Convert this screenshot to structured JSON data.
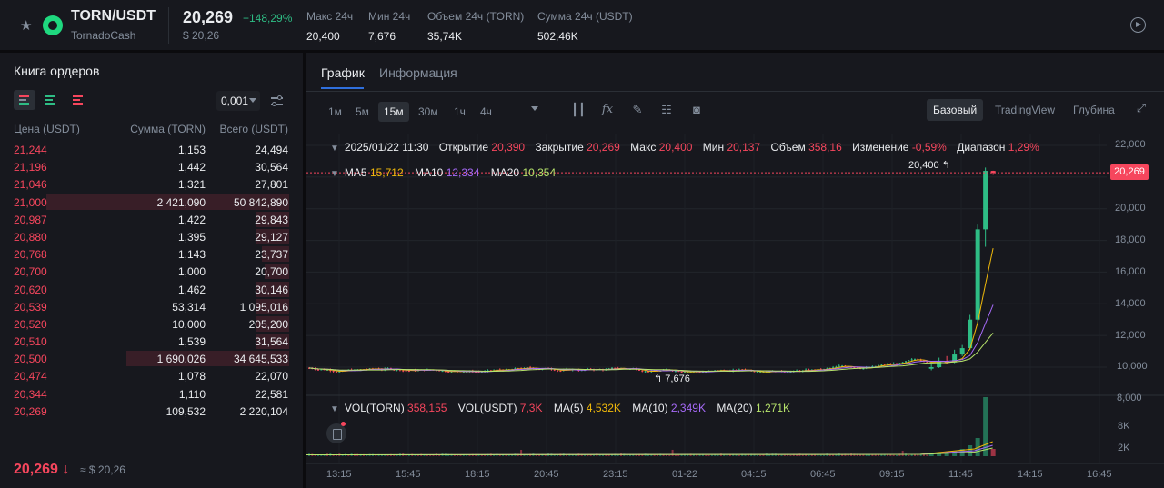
{
  "header": {
    "pair": "TORN/USDT",
    "name": "TornadoCash",
    "last_price": "20,269",
    "change": "+148,29%",
    "last_usd": "$ 20,26",
    "stats": [
      {
        "label": "Макс 24ч",
        "value": "20,400"
      },
      {
        "label": "Мин 24ч",
        "value": "7,676"
      },
      {
        "label": "Объем 24ч (TORN)",
        "value": "35,74K"
      },
      {
        "label": "Сумма 24ч (USDT)",
        "value": "502,46K"
      }
    ]
  },
  "orderbook": {
    "title": "Книга ордеров",
    "tick": "0,001",
    "col_price": "Цена (USDT)",
    "col_amount": "Сумма (TORN)",
    "col_total": "Всего (USDT)",
    "rows": [
      {
        "price": "21,244",
        "amount": "1,153",
        "total": "24,494",
        "depth": 0.0
      },
      {
        "price": "21,196",
        "amount": "1,442",
        "total": "30,564",
        "depth": 0.0
      },
      {
        "price": "21,046",
        "amount": "1,321",
        "total": "27,801",
        "depth": 0.0
      },
      {
        "price": "21,000",
        "amount": "2 421,090",
        "total": "50 842,890",
        "depth": 0.88
      },
      {
        "price": "20,987",
        "amount": "1,422",
        "total": "29,843",
        "depth": 0.12
      },
      {
        "price": "20,880",
        "amount": "1,395",
        "total": "29,127",
        "depth": 0.12
      },
      {
        "price": "20,768",
        "amount": "1,143",
        "total": "23,737",
        "depth": 0.1
      },
      {
        "price": "20,700",
        "amount": "1,000",
        "total": "20,700",
        "depth": 0.09
      },
      {
        "price": "20,620",
        "amount": "1,462",
        "total": "30,146",
        "depth": 0.12
      },
      {
        "price": "20,539",
        "amount": "53,314",
        "total": "1 095,016",
        "depth": 0.12
      },
      {
        "price": "20,520",
        "amount": "10,000",
        "total": "205,200",
        "depth": 0.12
      },
      {
        "price": "20,510",
        "amount": "1,539",
        "total": "31,564",
        "depth": 0.12
      },
      {
        "price": "20,500",
        "amount": "1 690,026",
        "total": "34 645,533",
        "depth": 0.59
      },
      {
        "price": "20,474",
        "amount": "1,078",
        "total": "22,070",
        "depth": 0.0
      },
      {
        "price": "20,344",
        "amount": "1,110",
        "total": "22,581",
        "depth": 0.0
      },
      {
        "price": "20,269",
        "amount": "109,532",
        "total": "2 220,104",
        "depth": 0.0
      }
    ],
    "last_price": "20,269",
    "last_arrow": "↓",
    "last_usd": "≈ $ 20,26"
  },
  "chart_panel": {
    "tabs": [
      "График",
      "Информация"
    ],
    "timeframes": [
      "1м",
      "5м",
      "15м",
      "30м",
      "1ч",
      "4ч"
    ],
    "active_timeframe": "15м",
    "views": [
      "Базовый",
      "TradingView",
      "Глубина"
    ],
    "active_view": "Базовый",
    "tools": [
      "candles-icon",
      "fx-icon",
      "pencil-icon",
      "layout-icon",
      "camera-icon",
      "fullscreen-icon"
    ]
  },
  "chart_info": {
    "datetime": "2025/01/22 11:30",
    "open_label": "Открытие",
    "open": "20,390",
    "close_label": "Закрытие",
    "close": "20,269",
    "high_label": "Макс",
    "high": "20,400",
    "low_label": "Мин",
    "low": "20,137",
    "volume_label": "Объем",
    "volume": "358,16",
    "change_label": "Изменение",
    "change": "-0,59%",
    "range_label": "Диапазон",
    "range": "1,29%",
    "ma5_label": "MA5",
    "ma5": "15,712",
    "ma10_label": "MA10",
    "ma10": "12,334",
    "ma20_label": "MA20",
    "ma20": "10,354",
    "vol_torn_label": "VOL(TORN)",
    "vol_torn": "358,155",
    "vol_usdt_label": "VOL(USDT)",
    "vol_usdt": "7,3K",
    "vma5_label": "MA(5)",
    "vma5": "4,532K",
    "vma10_label": "MA(10)",
    "vma10": "2,349K",
    "vma20_label": "MA(20)",
    "vma20": "1,271K",
    "price_tag": "20,269",
    "high_marker": "20,400",
    "low_marker": "7,676",
    "y_labels": [
      "22,000",
      "20,000",
      "18,000",
      "16,000",
      "14,000",
      "12,000",
      "10,000",
      "8,000"
    ],
    "vol_y_labels": [
      "8K",
      "2K"
    ],
    "x_labels": [
      "13:15",
      "15:45",
      "18:15",
      "20:45",
      "23:15",
      "01-22",
      "04:15",
      "06:45",
      "09:15",
      "11:45",
      "14:15",
      "16:45"
    ]
  },
  "chart_data": {
    "type": "candlestick",
    "ylim": [
      7000,
      22500
    ],
    "last_close": 20269,
    "high": 20400,
    "low": 7676,
    "candles_tail": [
      {
        "o": 7900,
        "c": 8000,
        "h": 8200,
        "l": 7800
      },
      {
        "o": 8000,
        "c": 8400,
        "h": 8600,
        "l": 7950
      },
      {
        "o": 8400,
        "c": 8300,
        "h": 8700,
        "l": 8200
      },
      {
        "o": 8300,
        "c": 8800,
        "h": 9100,
        "l": 8250
      },
      {
        "o": 8800,
        "c": 9200,
        "h": 9400,
        "l": 8700
      },
      {
        "o": 9200,
        "c": 11000,
        "h": 11300,
        "l": 9100
      },
      {
        "o": 11000,
        "c": 16700,
        "h": 17000,
        "l": 10800
      },
      {
        "o": 16700,
        "c": 20390,
        "h": 20600,
        "l": 15600
      },
      {
        "o": 20390,
        "c": 20269,
        "h": 20400,
        "l": 20137
      }
    ]
  },
  "colors": {
    "up": "#2ebd85",
    "down": "#f6465d",
    "ma5": "#f0b90b",
    "ma10": "#a66af8",
    "ma20": "#b6e36b",
    "accent": "#2f6fdd"
  }
}
